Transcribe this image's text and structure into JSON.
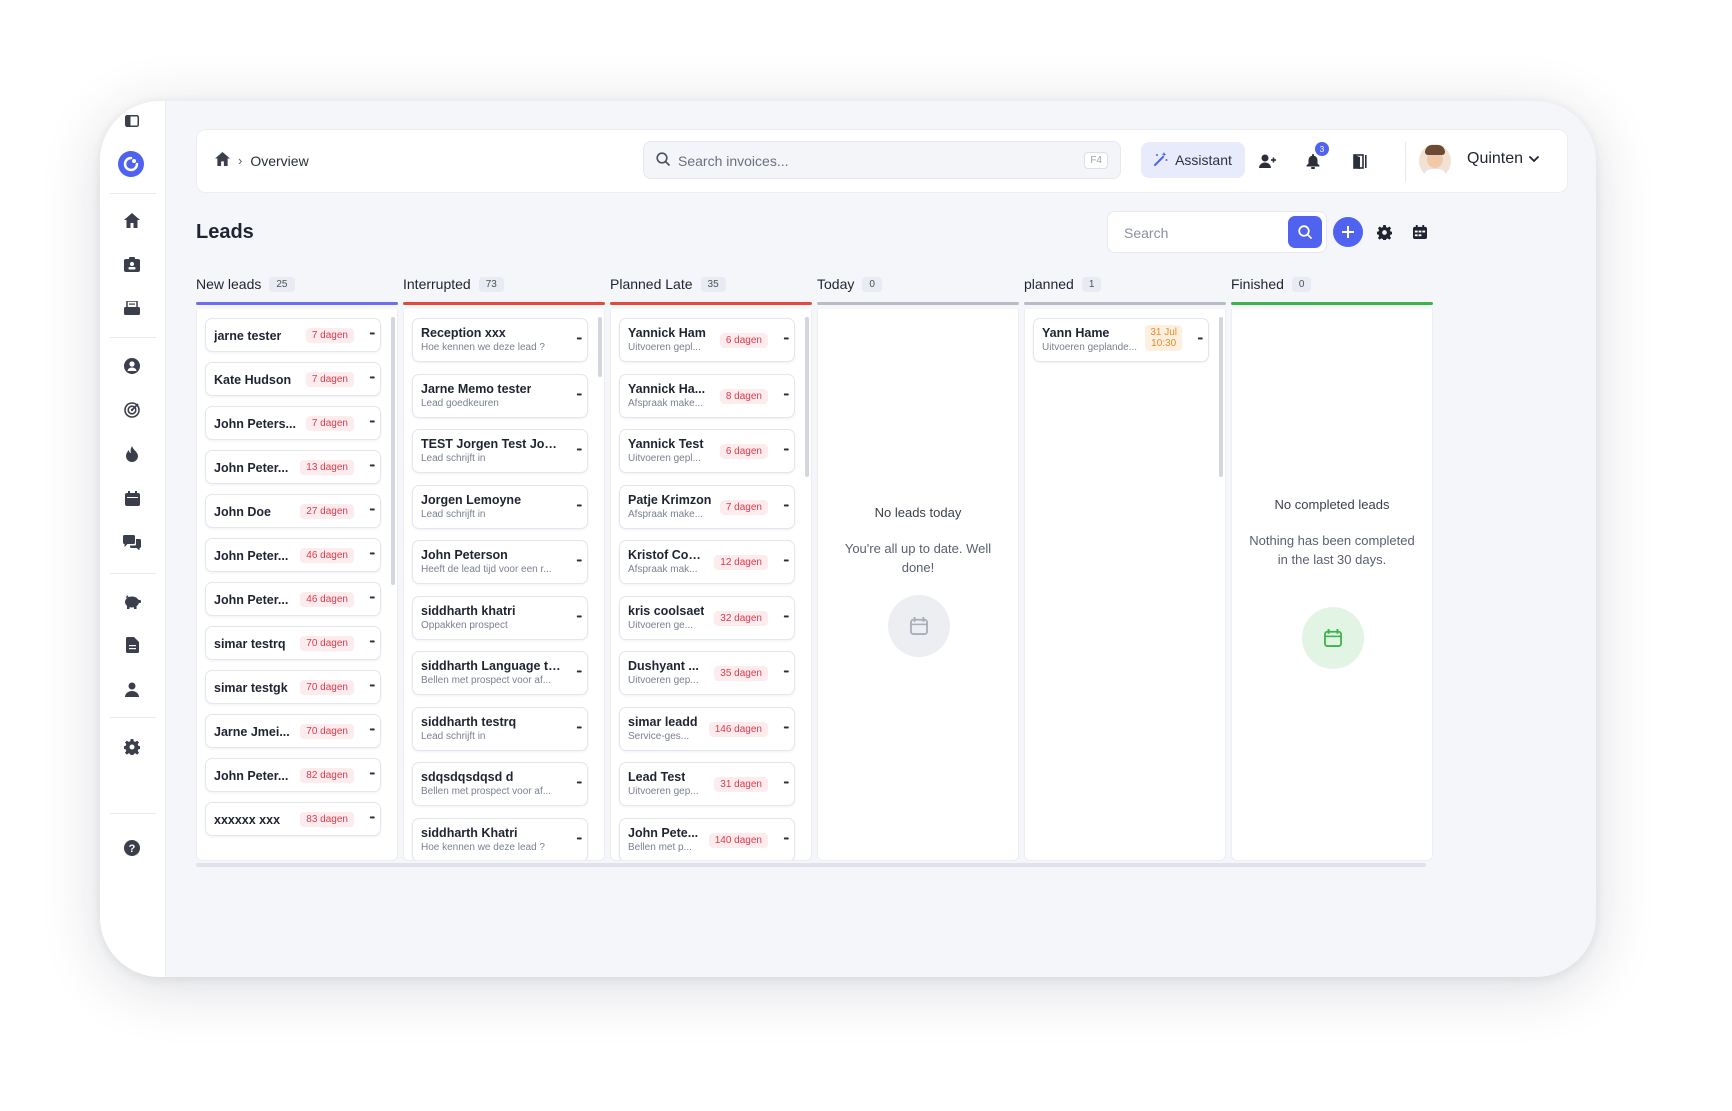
{
  "topbar": {
    "breadcrumb": "Overview",
    "search_placeholder": "Search invoices...",
    "search_shortcut": "F4",
    "assistant_label": "Assistant",
    "notification_count": "3",
    "user_name": "Quinten"
  },
  "page": {
    "title": "Leads",
    "search_placeholder": "Search"
  },
  "icons": {
    "sidebar": [
      "panel-toggle-icon",
      "logo-icon",
      "home-icon",
      "contacts-icon",
      "inbox-icon",
      "user-icon",
      "target-icon",
      "fire-icon",
      "calendar-icon",
      "chat-icon",
      "piggy-bank-icon",
      "document-icon",
      "team-icon",
      "settings-icon",
      "help-icon"
    ]
  },
  "colors": {
    "accent": "#4f63f0",
    "new_leads": "#6b6ff0",
    "interrupted": "#e24a3b",
    "planned_late": "#e24a3b",
    "today": "#b9bcc4",
    "planned": "#b9bcc4",
    "finished": "#3bb54a",
    "tag_red": "#e0394a",
    "tag_orange": "#f08a24"
  },
  "columns": [
    {
      "name": "New leads",
      "count": "25",
      "cards": [
        {
          "title": "jarne tester",
          "tag": "7 dagen"
        },
        {
          "title": "Kate Hudson",
          "tag": "7 dagen"
        },
        {
          "title": "John Peters...",
          "tag": "7 dagen"
        },
        {
          "title": "John Peter...",
          "tag": "13 dagen"
        },
        {
          "title": "John Doe",
          "tag": "27 dagen"
        },
        {
          "title": "John Peter...",
          "tag": "46 dagen"
        },
        {
          "title": "John Peter...",
          "tag": "46 dagen"
        },
        {
          "title": "simar testrq",
          "tag": "70 dagen"
        },
        {
          "title": "simar testgk",
          "tag": "70 dagen"
        },
        {
          "title": "Jarne Jmei...",
          "tag": "70 dagen"
        },
        {
          "title": "John Peter...",
          "tag": "82 dagen"
        },
        {
          "title": "xxxxxx xxx",
          "tag": "83 dagen"
        }
      ]
    },
    {
      "name": "Interrupted",
      "count": "73",
      "cards": [
        {
          "title": "Reception xxx",
          "sub": "Hoe kennen we deze lead ?"
        },
        {
          "title": "Jarne Memo tester",
          "sub": "Lead goedkeuren"
        },
        {
          "title": "TEST Jorgen Test Jorg...",
          "sub": "Lead schrijft in"
        },
        {
          "title": "Jorgen Lemoyne",
          "sub": "Lead schrijft in"
        },
        {
          "title": "John Peterson",
          "sub": "Heeft de lead tijd voor een r..."
        },
        {
          "title": "siddharth khatri",
          "sub": "Oppakken prospect"
        },
        {
          "title": "siddharth Language test",
          "sub": "Bellen met prospect voor af..."
        },
        {
          "title": "siddharth testrq",
          "sub": "Lead schrijft in"
        },
        {
          "title": "sdqsdqsdqsd d",
          "sub": "Bellen met prospect voor af..."
        },
        {
          "title": "siddharth Khatri",
          "sub": "Hoe kennen we deze lead ?"
        }
      ]
    },
    {
      "name": "Planned Late",
      "count": "35",
      "cards": [
        {
          "title": "Yannick Ham",
          "sub": "Uitvoeren gepl...",
          "tag": "6 dagen"
        },
        {
          "title": "Yannick Ha...",
          "sub": "Afspraak make...",
          "tag": "8 dagen"
        },
        {
          "title": "Yannick Test",
          "sub": "Uitvoeren gepl...",
          "tag": "6 dagen"
        },
        {
          "title": "Patje Krimzon",
          "sub": "Afspraak make...",
          "tag": "7 dagen"
        },
        {
          "title": "Kristof Coo...",
          "sub": "Afspraak mak...",
          "tag": "12 dagen"
        },
        {
          "title": "kris coolsaet",
          "sub": "Uitvoeren ge...",
          "tag": "32 dagen"
        },
        {
          "title": "Dushyant ...",
          "sub": "Uitvoeren gep...",
          "tag": "35 dagen"
        },
        {
          "title": "simar leadd",
          "sub": "Service-ges...",
          "tag": "146 dagen"
        },
        {
          "title": "Lead Test",
          "sub": "Uitvoeren gep...",
          "tag": "31 dagen"
        },
        {
          "title": "John Pete...",
          "sub": "Bellen met p...",
          "tag": "140 dagen"
        }
      ]
    },
    {
      "name": "Today",
      "count": "0",
      "empty_title": "No leads today",
      "empty_sub": "You're all up to date. Well done!"
    },
    {
      "name": "planned",
      "count": "1",
      "cards": [
        {
          "title": "Yann Hame",
          "sub": "Uitvoeren geplande...",
          "date": "31 Jul",
          "time": "10:30"
        }
      ]
    },
    {
      "name": "Finished",
      "count": "0",
      "empty_title": "No completed leads",
      "empty_sub": "Nothing has been completed in the last 30 days."
    }
  ]
}
